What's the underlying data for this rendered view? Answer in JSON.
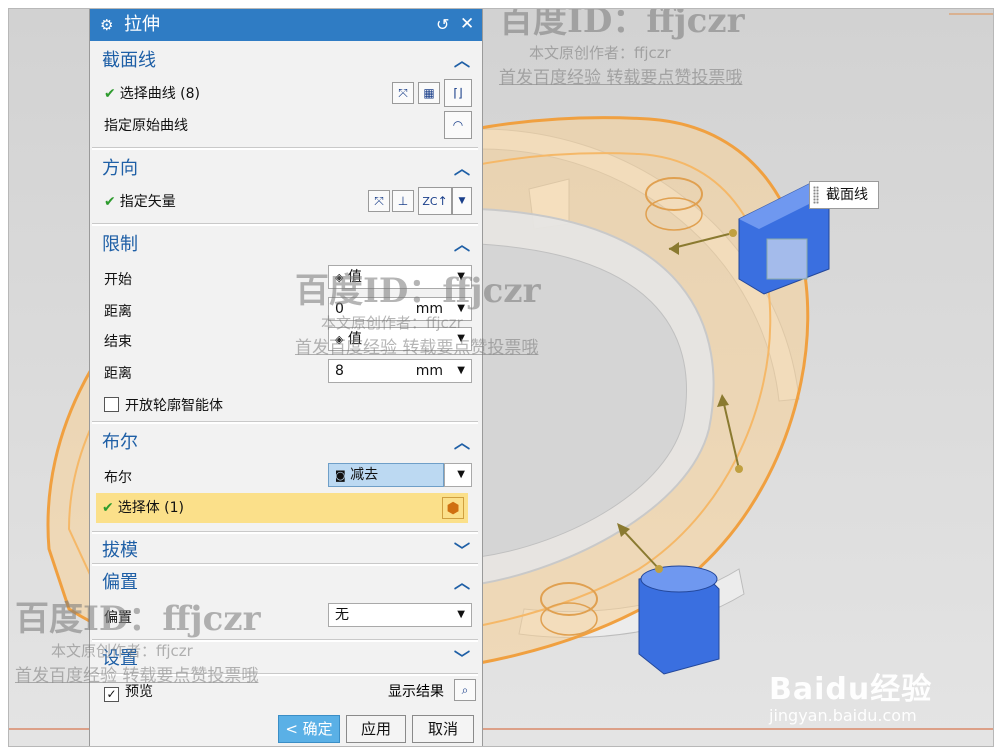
{
  "dialog": {
    "title": "拉伸",
    "reset_icon": "↺",
    "close_icon": "✕",
    "sections": {
      "section_curve": {
        "title": "截面线",
        "select_curve": "选择曲线 (8)",
        "specify_origin": "指定原始曲线"
      },
      "direction": {
        "title": "方向",
        "specify_vector": "指定矢量",
        "zc_label": "ZC"
      },
      "limits": {
        "title": "限制",
        "start_label": "开始",
        "start_value": "值",
        "distance1_label": "距离",
        "distance1_value": "0",
        "distance1_unit": "mm",
        "end_label": "结束",
        "end_value": "值",
        "distance2_label": "距离",
        "distance2_value": "8",
        "distance2_unit": "mm",
        "open_profile": "开放轮廓智能体",
        "open_profile_checked": false
      },
      "boolean": {
        "title": "布尔",
        "boolean_label": "布尔",
        "boolean_value": "减去",
        "select_body": "选择体 (1)"
      },
      "draft": {
        "title": "拔模"
      },
      "offset": {
        "title": "偏置",
        "offset_label": "偏置",
        "offset_value": "无"
      },
      "settings": {
        "title": "设置"
      }
    },
    "preview_label": "预览",
    "preview_checked": true,
    "show_result": "显示结果",
    "buttons": {
      "ok": "< 确定 >",
      "apply": "应用",
      "cancel": "取消"
    }
  },
  "viewport": {
    "callout_label": "截面线"
  },
  "watermarks": {
    "id_text": "百度ID：ffjczr",
    "author_text": "本文原创作者：ffjczr",
    "notice_text": "首发百度经验 转载要点赞投票哦",
    "brand_logo": "Baidu经验",
    "brand_url": "jingyan.baidu.com"
  },
  "colors": {
    "title_bar": "#2f7cc4",
    "section_title": "#1e5fa6",
    "highlight_row": "#fbe08a",
    "ring": "#f0a040",
    "cylinder": "#2f63d6"
  }
}
